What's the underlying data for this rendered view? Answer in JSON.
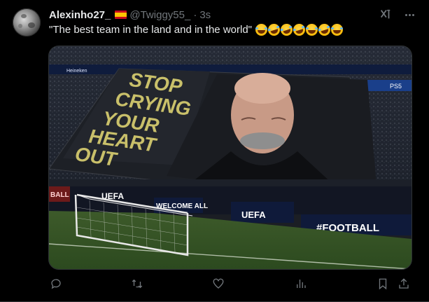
{
  "tweet": {
    "display_name": "Alexinho27_",
    "flag": "spain-flag",
    "handle": "@Twiggy55_",
    "separator": "·",
    "time": "3s",
    "text": "\"The best team in the land and in the world\"",
    "emojis": [
      "face-with-tears-of-joy",
      "rolling-on-the-floor-laughing",
      "rolling-on-the-floor-laughing",
      "rolling-on-the-floor-laughing",
      "face-with-tears-of-joy",
      "rolling-on-the-floor-laughing",
      "face-with-tears-of-joy"
    ]
  },
  "media": {
    "banner_lines": [
      "STOP",
      "CRYING",
      "YOUR",
      "HEART",
      "OUT"
    ],
    "board_left": "UEFA",
    "board_welcome": "WELCOME ALL",
    "board_uefa": "UEFA",
    "board_football": "#FOOTBALL",
    "board_small_left": "BALL",
    "top_sponsor": "Heineken",
    "top_right_logo": "PS5"
  },
  "actions": [
    "reply-icon",
    "retweet-icon",
    "like-icon",
    "views-icon",
    "bookmark-icon",
    "share-icon"
  ],
  "colors": {
    "background": "#000000",
    "text": "#e7e9ea",
    "muted": "#71767b",
    "banner_text": "#c9c06a"
  }
}
